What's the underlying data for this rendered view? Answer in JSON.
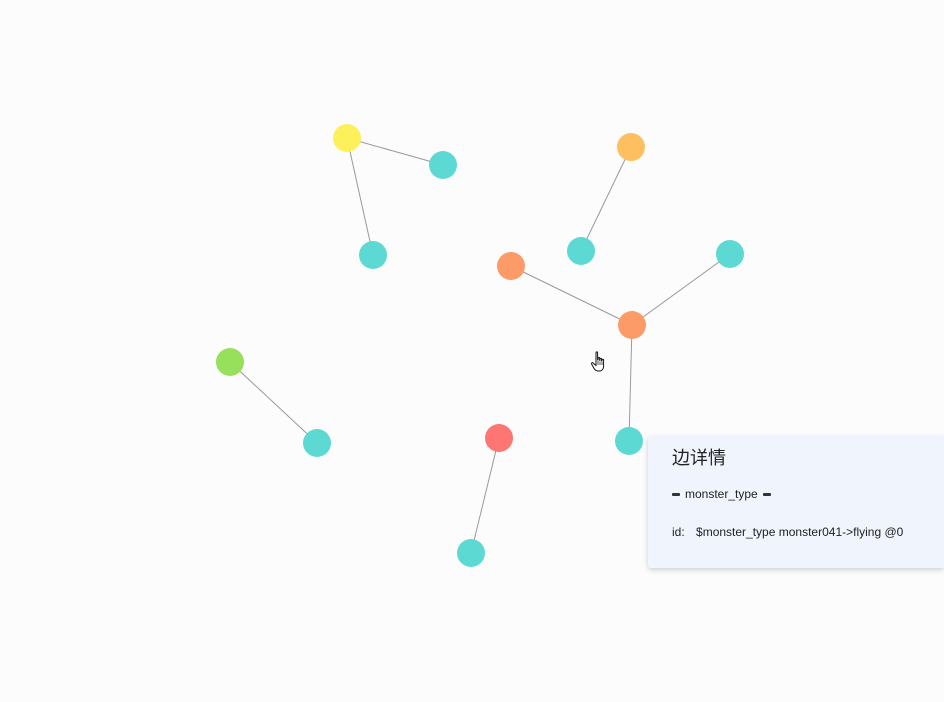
{
  "graph": {
    "nodes": [
      {
        "id": "n1",
        "color": "#fdf15b"
      },
      {
        "id": "n2",
        "color": "#5dd9d3"
      },
      {
        "id": "n3",
        "color": "#5dd9d3"
      },
      {
        "id": "n4",
        "color": "#fdbf60"
      },
      {
        "id": "n5",
        "color": "#5dd9d3"
      },
      {
        "id": "n6",
        "color": "#fc9a68"
      },
      {
        "id": "n7",
        "color": "#fc9a68"
      },
      {
        "id": "n8",
        "color": "#5dd9d3"
      },
      {
        "id": "n9",
        "color": "#5dd9d3"
      },
      {
        "id": "n10",
        "color": "#97e05b"
      },
      {
        "id": "n11",
        "color": "#5dd9d3"
      },
      {
        "id": "n12",
        "color": "#fd7674"
      },
      {
        "id": "n13",
        "color": "#5dd9d3"
      }
    ],
    "edges": [
      {
        "source": "n1",
        "target": "n2"
      },
      {
        "source": "n1",
        "target": "n3"
      },
      {
        "source": "n4",
        "target": "n5"
      },
      {
        "source": "n6",
        "target": "n7"
      },
      {
        "source": "n7",
        "target": "n8"
      },
      {
        "source": "n7",
        "target": "n9"
      },
      {
        "source": "n10",
        "target": "n11"
      },
      {
        "source": "n12",
        "target": "n13"
      }
    ]
  },
  "cursor": {
    "icon": "hand-pointer-icon"
  },
  "panel": {
    "title": "边详情",
    "edge_type": "monster_type",
    "id_label": "id:",
    "id_value": "$monster_type monster041->flying @0"
  }
}
